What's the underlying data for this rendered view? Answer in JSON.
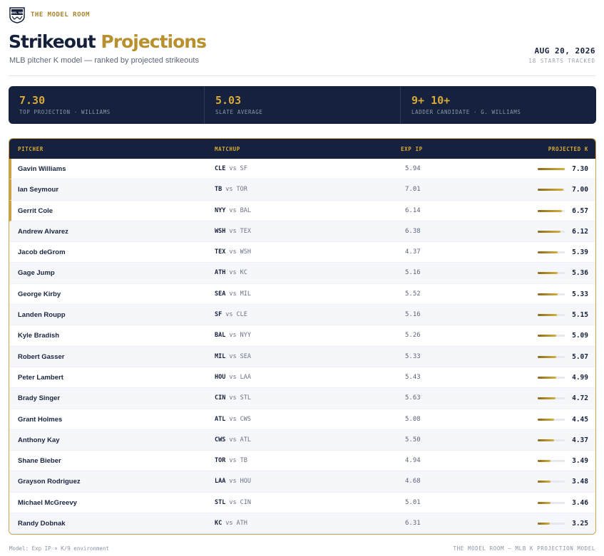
{
  "brand": {
    "name": "THE MODEL ROOM",
    "logo_text": "MODEL ROOM",
    "logo_icon": "shield-logo"
  },
  "header": {
    "title_part1": "Strikeout",
    "title_part2": "Projections",
    "subtitle": "MLB pitcher K model — ranked by projected strikeouts",
    "date": "AUG 20, 2026",
    "starts_tracked": "18 STARTS TRACKED"
  },
  "stats": [
    {
      "value": "7.30",
      "label": "TOP PROJECTION · WILLIAMS"
    },
    {
      "value": "5.03",
      "label": "SLATE AVERAGE"
    },
    {
      "value": "9+ 10+",
      "label": "LADDER CANDIDATE · G. WILLIAMS"
    }
  ],
  "table": {
    "columns": [
      "PITCHER",
      "MATCHUP",
      "EXP IP",
      "PROJECTED K"
    ],
    "vs_label": "vs",
    "max_k": 7.3,
    "rows": [
      {
        "pitcher": "Gavin Williams",
        "team": "CLE",
        "opp": "SF",
        "exp_ip": "5.94",
        "k": "7.30",
        "top": true
      },
      {
        "pitcher": "Ian Seymour",
        "team": "TB",
        "opp": "TOR",
        "exp_ip": "7.01",
        "k": "7.00",
        "top": true
      },
      {
        "pitcher": "Gerrit Cole",
        "team": "NYY",
        "opp": "BAL",
        "exp_ip": "6.14",
        "k": "6.57",
        "top": true
      },
      {
        "pitcher": "Andrew Alvarez",
        "team": "WSH",
        "opp": "TEX",
        "exp_ip": "6.38",
        "k": "6.12",
        "top": false
      },
      {
        "pitcher": "Jacob deGrom",
        "team": "TEX",
        "opp": "WSH",
        "exp_ip": "4.37",
        "k": "5.39",
        "top": false
      },
      {
        "pitcher": "Gage Jump",
        "team": "ATH",
        "opp": "KC",
        "exp_ip": "5.16",
        "k": "5.36",
        "top": false
      },
      {
        "pitcher": "George Kirby",
        "team": "SEA",
        "opp": "MIL",
        "exp_ip": "5.52",
        "k": "5.33",
        "top": false
      },
      {
        "pitcher": "Landen Roupp",
        "team": "SF",
        "opp": "CLE",
        "exp_ip": "5.16",
        "k": "5.15",
        "top": false
      },
      {
        "pitcher": "Kyle Bradish",
        "team": "BAL",
        "opp": "NYY",
        "exp_ip": "5.26",
        "k": "5.09",
        "top": false
      },
      {
        "pitcher": "Robert Gasser",
        "team": "MIL",
        "opp": "SEA",
        "exp_ip": "5.33",
        "k": "5.07",
        "top": false
      },
      {
        "pitcher": "Peter Lambert",
        "team": "HOU",
        "opp": "LAA",
        "exp_ip": "5.43",
        "k": "4.99",
        "top": false
      },
      {
        "pitcher": "Brady Singer",
        "team": "CIN",
        "opp": "STL",
        "exp_ip": "5.63",
        "k": "4.72",
        "top": false
      },
      {
        "pitcher": "Grant Holmes",
        "team": "ATL",
        "opp": "CWS",
        "exp_ip": "5.08",
        "k": "4.45",
        "top": false
      },
      {
        "pitcher": "Anthony Kay",
        "team": "CWS",
        "opp": "ATL",
        "exp_ip": "5.50",
        "k": "4.37",
        "top": false
      },
      {
        "pitcher": "Shane Bieber",
        "team": "TOR",
        "opp": "TB",
        "exp_ip": "4.94",
        "k": "3.49",
        "top": false
      },
      {
        "pitcher": "Grayson Rodriguez",
        "team": "LAA",
        "opp": "HOU",
        "exp_ip": "4.68",
        "k": "3.48",
        "top": false
      },
      {
        "pitcher": "Michael McGreevy",
        "team": "STL",
        "opp": "CIN",
        "exp_ip": "5.01",
        "k": "3.46",
        "top": false
      },
      {
        "pitcher": "Randy Dobnak",
        "team": "KC",
        "opp": "ATH",
        "exp_ip": "6.31",
        "k": "3.25",
        "top": false
      }
    ]
  },
  "footer": {
    "left": "Model: Exp IP × K/9 environment",
    "right": "THE MODEL ROOM — MLB K PROJECTION MODEL"
  },
  "colors": {
    "navy": "#15213d",
    "gold": "#d8a93a",
    "gold_border": "#c9a24a"
  }
}
